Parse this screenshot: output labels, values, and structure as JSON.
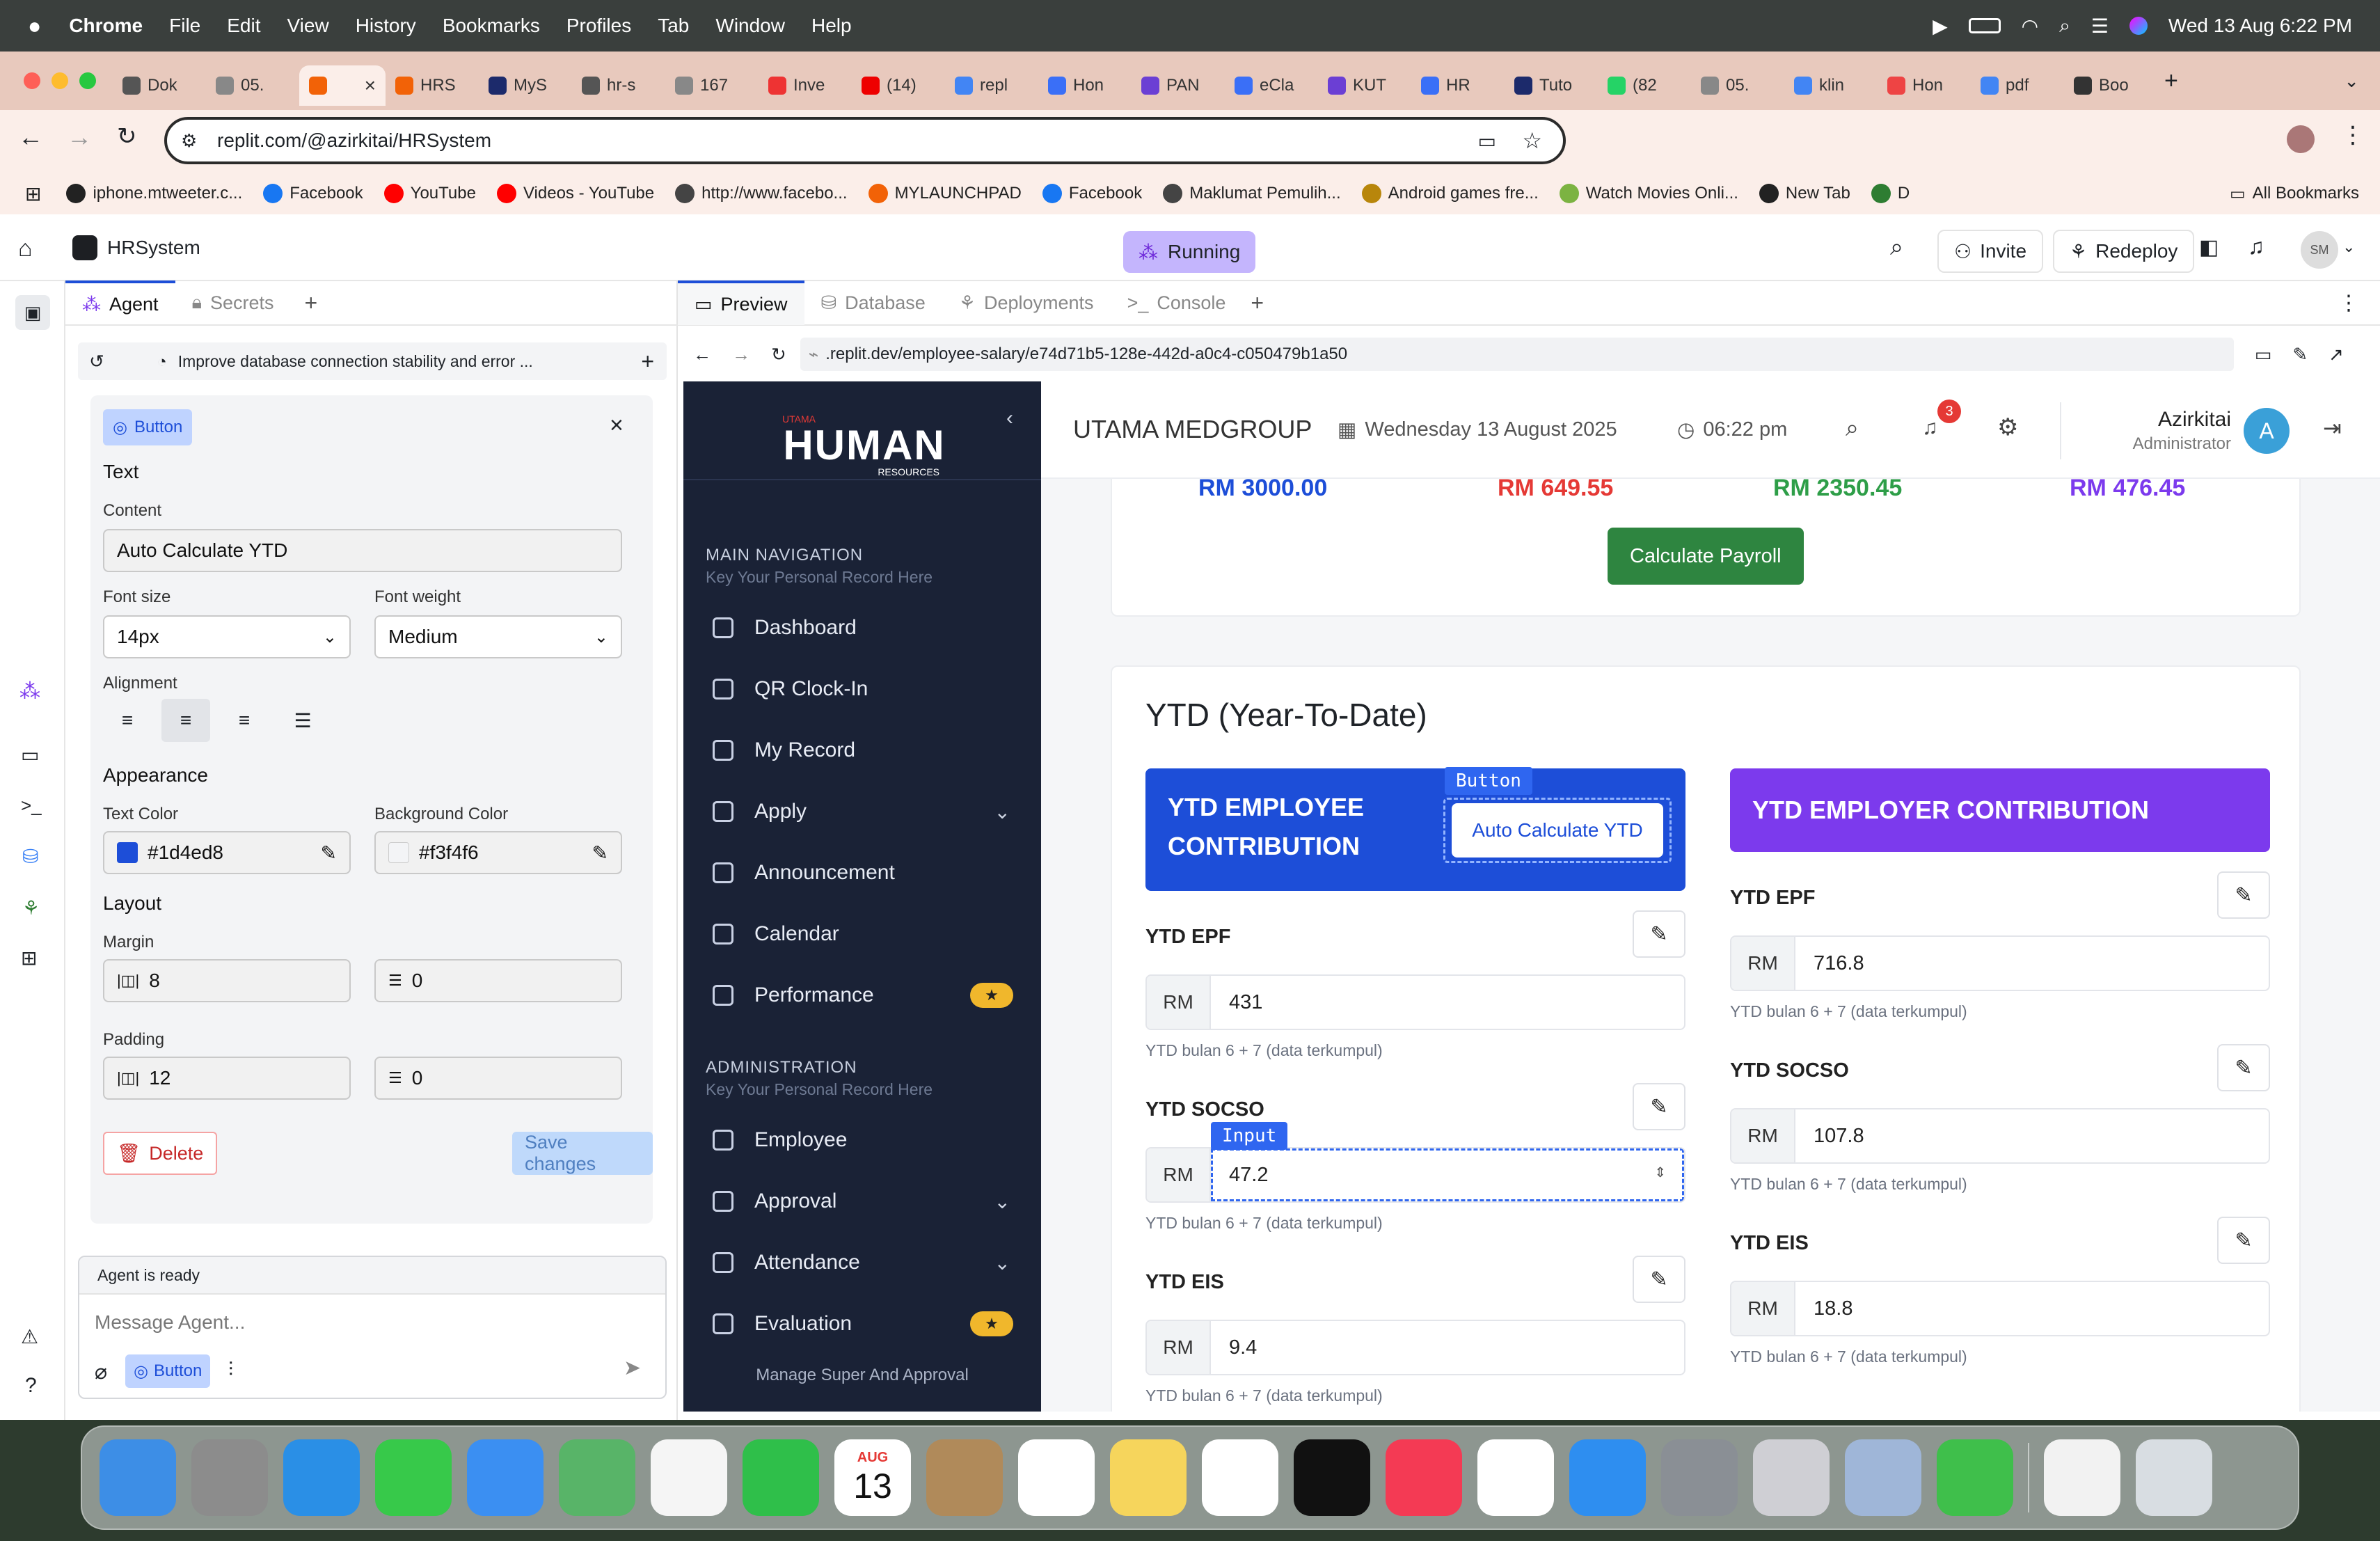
{
  "menubar": {
    "app": "Chrome",
    "items": [
      "File",
      "Edit",
      "View",
      "History",
      "Bookmarks",
      "Profiles",
      "Tab",
      "Window",
      "Help"
    ],
    "datetime": "Wed 13 Aug  6:22 PM"
  },
  "tabs": [
    {
      "label": "Dok",
      "color": "#555"
    },
    {
      "label": "05.",
      "color": "#888"
    },
    {
      "label": "",
      "color": "#f26207"
    },
    {
      "label": "HRS",
      "color": "#f26207"
    },
    {
      "label": "MyS",
      "color": "#1c2a6b"
    },
    {
      "label": "hr-s",
      "color": "#555"
    },
    {
      "label": "167",
      "color": "#888"
    },
    {
      "label": "Inve",
      "color": "#e33"
    },
    {
      "label": "(14)",
      "color": "#e00"
    },
    {
      "label": "repl",
      "color": "#4285f4"
    },
    {
      "label": "Hon",
      "color": "#3a6ff7"
    },
    {
      "label": "PAN",
      "color": "#6b3fd4"
    },
    {
      "label": "eCla",
      "color": "#3a6ff7"
    },
    {
      "label": "KUT",
      "color": "#6b3fd4"
    },
    {
      "label": "HR",
      "color": "#3a6ff7"
    },
    {
      "label": "Tuto",
      "color": "#1c2a6b"
    },
    {
      "label": "(82",
      "color": "#25d366"
    },
    {
      "label": "05.",
      "color": "#888"
    },
    {
      "label": "klin",
      "color": "#4285f4"
    },
    {
      "label": "Hon",
      "color": "#e44"
    },
    {
      "label": "pdf",
      "color": "#4285f4"
    },
    {
      "label": "Boo",
      "color": "#333"
    }
  ],
  "address": {
    "url": "replit.com/@azirkitai/HRSystem"
  },
  "bookmarks": [
    {
      "label": "iphone.mtweeter.c...",
      "color": "#222"
    },
    {
      "label": "Facebook",
      "color": "#1877f2"
    },
    {
      "label": "YouTube",
      "color": "#ff0000"
    },
    {
      "label": "Videos - YouTube",
      "color": "#ff0000"
    },
    {
      "label": "http://www.facebo...",
      "color": "#444"
    },
    {
      "label": "MYLAUNCHPAD",
      "color": "#f26207"
    },
    {
      "label": "Facebook",
      "color": "#1877f2"
    },
    {
      "label": "Maklumat Pemulih...",
      "color": "#444"
    },
    {
      "label": "Android games fre...",
      "color": "#b8860b"
    },
    {
      "label": "Watch Movies Onli...",
      "color": "#7cb342"
    },
    {
      "label": "New Tab",
      "color": "#222"
    },
    {
      "label": "D",
      "color": "#2e7d32"
    }
  ],
  "all_bookmarks": "All Bookmarks",
  "replit": {
    "project": "HRSystem",
    "status": "Running",
    "invite": "Invite",
    "redeploy": "Redeploy",
    "avatar": "SM",
    "left_tabs": [
      "Agent",
      "Secrets"
    ],
    "right_tabs": [
      "Preview",
      "Database",
      "Deployments",
      "Console"
    ],
    "thread_title": "Improve database connection stability and error ...",
    "preview_url": ".replit.dev/employee-salary/e74d71b5-128e-442d-a0c4-c050479b1a50",
    "agent_ready": "Agent is ready",
    "message_placeholder": "Message Agent...",
    "chip": "Button"
  },
  "editor": {
    "badge": "Button",
    "text_section": "Text",
    "content_label": "Content",
    "content_value": "Auto Calculate YTD",
    "font_size_label": "Font size",
    "font_size": "14px",
    "font_weight_label": "Font weight",
    "font_weight": "Medium",
    "alignment_label": "Alignment",
    "appearance": "Appearance",
    "text_color_label": "Text Color",
    "text_color": "#1d4ed8",
    "bg_color_label": "Background Color",
    "bg_color": "#f3f4f6",
    "layout": "Layout",
    "margin_label": "Margin",
    "margin_x": "8",
    "margin_y": "0",
    "padding_label": "Padding",
    "padding_x": "12",
    "padding_y": "0",
    "delete": "Delete",
    "save": "Save changes"
  },
  "app": {
    "brand_top": "UTAMA",
    "brand_main": "HUMAN",
    "brand_sub": "RESOURCES",
    "company": "UTAMA MEDGROUP",
    "date": "Wednesday 13 August 2025",
    "time": "06:22 pm",
    "notif_count": "3",
    "user_name": "Azirkitai",
    "user_role": "Administrator",
    "user_initial": "A",
    "main_nav_title": "MAIN NAVIGATION",
    "main_nav_sub": "Key Your Personal Record Here",
    "admin_title": "ADMINISTRATION",
    "admin_sub": "Key Your Personal Record Here",
    "nav_main": [
      {
        "label": "Dashboard",
        "badge": "",
        "chev": ""
      },
      {
        "label": "QR Clock-In",
        "badge": "",
        "chev": ""
      },
      {
        "label": "My Record",
        "badge": "",
        "chev": ""
      },
      {
        "label": "Apply",
        "badge": "",
        "chev": "⌄"
      },
      {
        "label": "Announcement",
        "badge": "",
        "chev": ""
      },
      {
        "label": "Calendar",
        "badge": "",
        "chev": ""
      },
      {
        "label": "Performance",
        "badge": "★",
        "chev": ""
      }
    ],
    "nav_admin": [
      {
        "label": "Employee",
        "badge": "",
        "chev": ""
      },
      {
        "label": "Approval",
        "badge": "",
        "chev": "⌄"
      },
      {
        "label": "Attendance",
        "badge": "",
        "chev": "⌄"
      },
      {
        "label": "Evaluation",
        "badge": "★",
        "chev": ""
      }
    ],
    "sidebar_footer": "Manage Super And Approval",
    "totals": [
      "RM 3000.00",
      "RM 649.55",
      "RM 2350.45",
      "RM 476.45"
    ],
    "calc_payroll": "Calculate Payroll",
    "ytd_title": "YTD (Year-To-Date)",
    "emp_header": "YTD EMPLOYEE CONTRIBUTION",
    "auto_btn": "Auto Calculate YTD",
    "button_tag": "Button",
    "input_tag": "Input",
    "employer_header": "YTD EMPLOYER CONTRIBUTION",
    "currency": "RM",
    "hint": "YTD bulan 6 + 7 (data terkumpul)",
    "employee_fields": [
      {
        "label": "YTD EPF",
        "value": "431"
      },
      {
        "label": "YTD SOCSO",
        "value": "47.2"
      },
      {
        "label": "YTD EIS",
        "value": "9.4"
      }
    ],
    "employer_fields": [
      {
        "label": "YTD EPF",
        "value": "716.8"
      },
      {
        "label": "YTD SOCSO",
        "value": "107.8"
      },
      {
        "label": "YTD EIS",
        "value": "18.8"
      }
    ]
  },
  "dock": {
    "calendar_month": "AUG",
    "calendar_day": "13",
    "apps": [
      {
        "name": "finder",
        "color": "#3d8ee6"
      },
      {
        "name": "launchpad",
        "color": "#8c8c8c"
      },
      {
        "name": "safari",
        "color": "#2a8fe6"
      },
      {
        "name": "messages",
        "color": "#37c94a"
      },
      {
        "name": "mail",
        "color": "#3b8ff2"
      },
      {
        "name": "maps",
        "color": "#58b468"
      },
      {
        "name": "photos",
        "color": "#f5f5f5"
      },
      {
        "name": "facetime",
        "color": "#2fbf4a"
      },
      {
        "name": "calendar",
        "color": "#ffffff"
      },
      {
        "name": "contacts",
        "color": "#b08a5a"
      },
      {
        "name": "reminders",
        "color": "#ffffff"
      },
      {
        "name": "notes",
        "color": "#f6d55c"
      },
      {
        "name": "freeform",
        "color": "#ffffff"
      },
      {
        "name": "tv",
        "color": "#111111"
      },
      {
        "name": "music",
        "color": "#f43a54"
      },
      {
        "name": "chrome",
        "color": "#ffffff"
      },
      {
        "name": "app-store",
        "color": "#2e8ef0"
      },
      {
        "name": "settings",
        "color": "#8a8f95"
      },
      {
        "name": "iphone-mirroring",
        "color": "#cfcfd4"
      },
      {
        "name": "preview",
        "color": "#9fb6d8"
      },
      {
        "name": "numbers",
        "color": "#3fbf4b"
      },
      {
        "name": "document",
        "color": "#f2f2f2"
      },
      {
        "name": "trash",
        "color": "#d8dde2"
      }
    ]
  }
}
